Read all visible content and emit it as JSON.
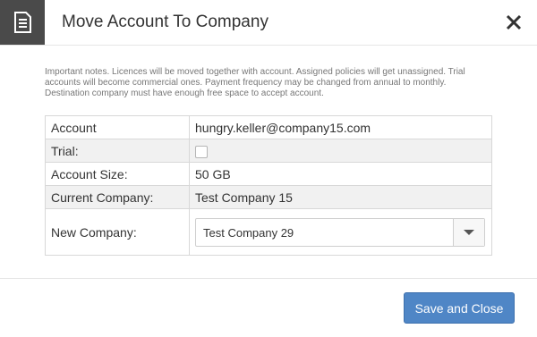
{
  "dialog": {
    "title": "Move Account To Company",
    "header_icon": "document-icon",
    "close_icon": "close-icon"
  },
  "notes": "Important notes. Licences will be moved together with account. Assigned policies will get unassigned. Trial accounts will become commercial ones. Payment frequency may be changed from annual to monthly. Destination company must have enough free space to accept account.",
  "fields": {
    "account_label": "Account",
    "account_value": "hungry.keller@company15.com",
    "trial_label": "Trial:",
    "trial_checked": false,
    "size_label": "Account Size:",
    "size_value": "50 GB",
    "current_company_label": "Current Company:",
    "current_company_value": "Test Company 15",
    "new_company_label": "New Company:",
    "new_company_value": "Test Company 29"
  },
  "footer": {
    "save_label": "Save and Close"
  },
  "colors": {
    "header_icon_bg": "#4a4a4a",
    "primary_button": "#4f86c6",
    "alt_row": "#f1f1f1"
  }
}
